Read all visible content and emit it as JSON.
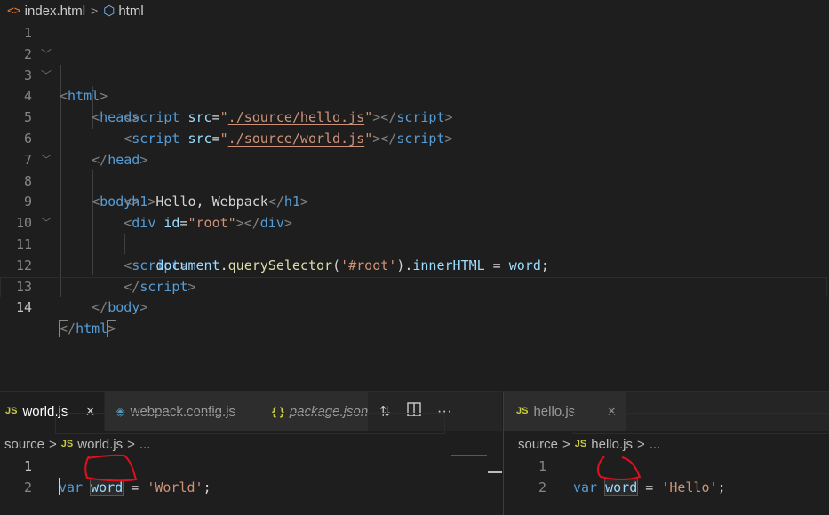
{
  "top_editor": {
    "breadcrumb": {
      "file": "index.html",
      "symbol": "html"
    },
    "lines": [
      {
        "n": "1"
      },
      {
        "n": "2"
      },
      {
        "n": "3"
      },
      {
        "n": "4"
      },
      {
        "n": "5"
      },
      {
        "n": "6"
      },
      {
        "n": "7"
      },
      {
        "n": "8"
      },
      {
        "n": "9"
      },
      {
        "n": "10"
      },
      {
        "n": "11"
      },
      {
        "n": "12"
      },
      {
        "n": "13"
      },
      {
        "n": "14"
      }
    ],
    "code": {
      "l2_tag": "html",
      "l3_tag": "head",
      "l4_tag": "script",
      "l4_attr": "src",
      "l4_val": "./source/hello.js",
      "l4_close": "script",
      "l5_tag": "script",
      "l5_attr": "src",
      "l5_val": "./source/world.js",
      "l5_close": "script",
      "l6_close": "head",
      "l7_tag": "body",
      "l8_tag": "h1",
      "l8_text": "Hello, Webpack",
      "l8_close": "h1",
      "l9_tag": "div",
      "l9_attr": "id",
      "l9_val": "\"root\"",
      "l9_close": "div",
      "l10_tag": "script",
      "l11_obj": "document",
      "l11_fn": "querySelector",
      "l11_arg": "'#root'",
      "l11_prop": "innerHTML",
      "l11_var": "word",
      "l12_close": "script",
      "l13_close": "body",
      "l14_close": "html"
    }
  },
  "left_pane": {
    "tabs": [
      {
        "label": "world.js",
        "icon": "js-icon",
        "active": true,
        "close": "×"
      },
      {
        "label": "webpack.config.js",
        "icon": "webpack-icon"
      },
      {
        "label": "package.json",
        "icon": "json-icon",
        "badge": "{ }"
      }
    ],
    "actions": [
      "compare-changes-icon",
      "split-editor-icon",
      "more-actions-icon"
    ],
    "more_label": "···",
    "breadcrumb": {
      "folder": "source",
      "file": "world.js",
      "tail": "..."
    },
    "lines": [
      "1",
      "2"
    ],
    "code": {
      "kw": "var",
      "name": "word",
      "eq": "=",
      "val": "'World'",
      "semi": ";"
    }
  },
  "right_pane": {
    "tabs": [
      {
        "label": "hello.js",
        "icon": "js-icon",
        "active": false,
        "close": "×"
      }
    ],
    "breadcrumb": {
      "folder": "source",
      "file": "hello.js",
      "tail": "..."
    },
    "lines": [
      "1",
      "2"
    ],
    "code": {
      "kw": "var",
      "name": "word",
      "eq": "=",
      "val": "'Hello'",
      "semi": ";"
    }
  },
  "js_badge": "JS",
  "colors": {
    "background": "#1e1e1e",
    "tag": "#569cd6",
    "string": "#ce9178",
    "attribute": "#9cdcfe",
    "annotation": "#e0101e"
  }
}
